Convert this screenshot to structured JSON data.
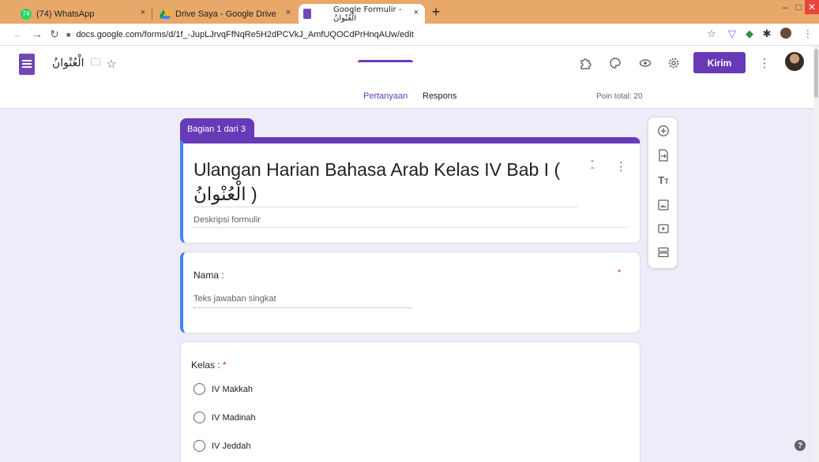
{
  "browser": {
    "tabs": [
      {
        "title": "(74) WhatsApp",
        "icon": "whatsapp-icon",
        "badge": "74"
      },
      {
        "title": "Drive Saya - Google Drive",
        "icon": "google-drive-icon"
      },
      {
        "title": "Google Formulir - الْعُنْوانُ",
        "icon": "google-forms-icon"
      }
    ],
    "close_glyph": "×",
    "new_tab": "+",
    "url": "docs.google.com/forms/d/1f_-JupLJrvqFfNqRe5H2dPCVkJ_AmfUQOCdPrHnqAUw/edit"
  },
  "header": {
    "doc_title": "الْعُنْوانُ",
    "send_label": "Kirim",
    "tabs": [
      {
        "label": "Pertanyaan"
      },
      {
        "label": "Respons"
      }
    ],
    "points": "Poin total: 20"
  },
  "section": {
    "tag": "Bagian 1 dari 3"
  },
  "form": {
    "title": "Ulangan Harian Bahasa Arab Kelas IV Bab I ( الْعُنْوانُ )",
    "description_placeholder": "Deskripsi formulir"
  },
  "questions": [
    {
      "label": "Nama :",
      "required": "*",
      "answer_placeholder": "Teks jawaban singkat"
    },
    {
      "label": "Kelas : ",
      "required": "*",
      "options": [
        "IV Makkah",
        "IV Madinah",
        "IV Jeddah"
      ]
    }
  ],
  "help": "?",
  "colors": {
    "accent": "#673ab7",
    "focus": "#4285f4",
    "background": "#f0ebf8",
    "tabbar": "#e8a86a"
  }
}
